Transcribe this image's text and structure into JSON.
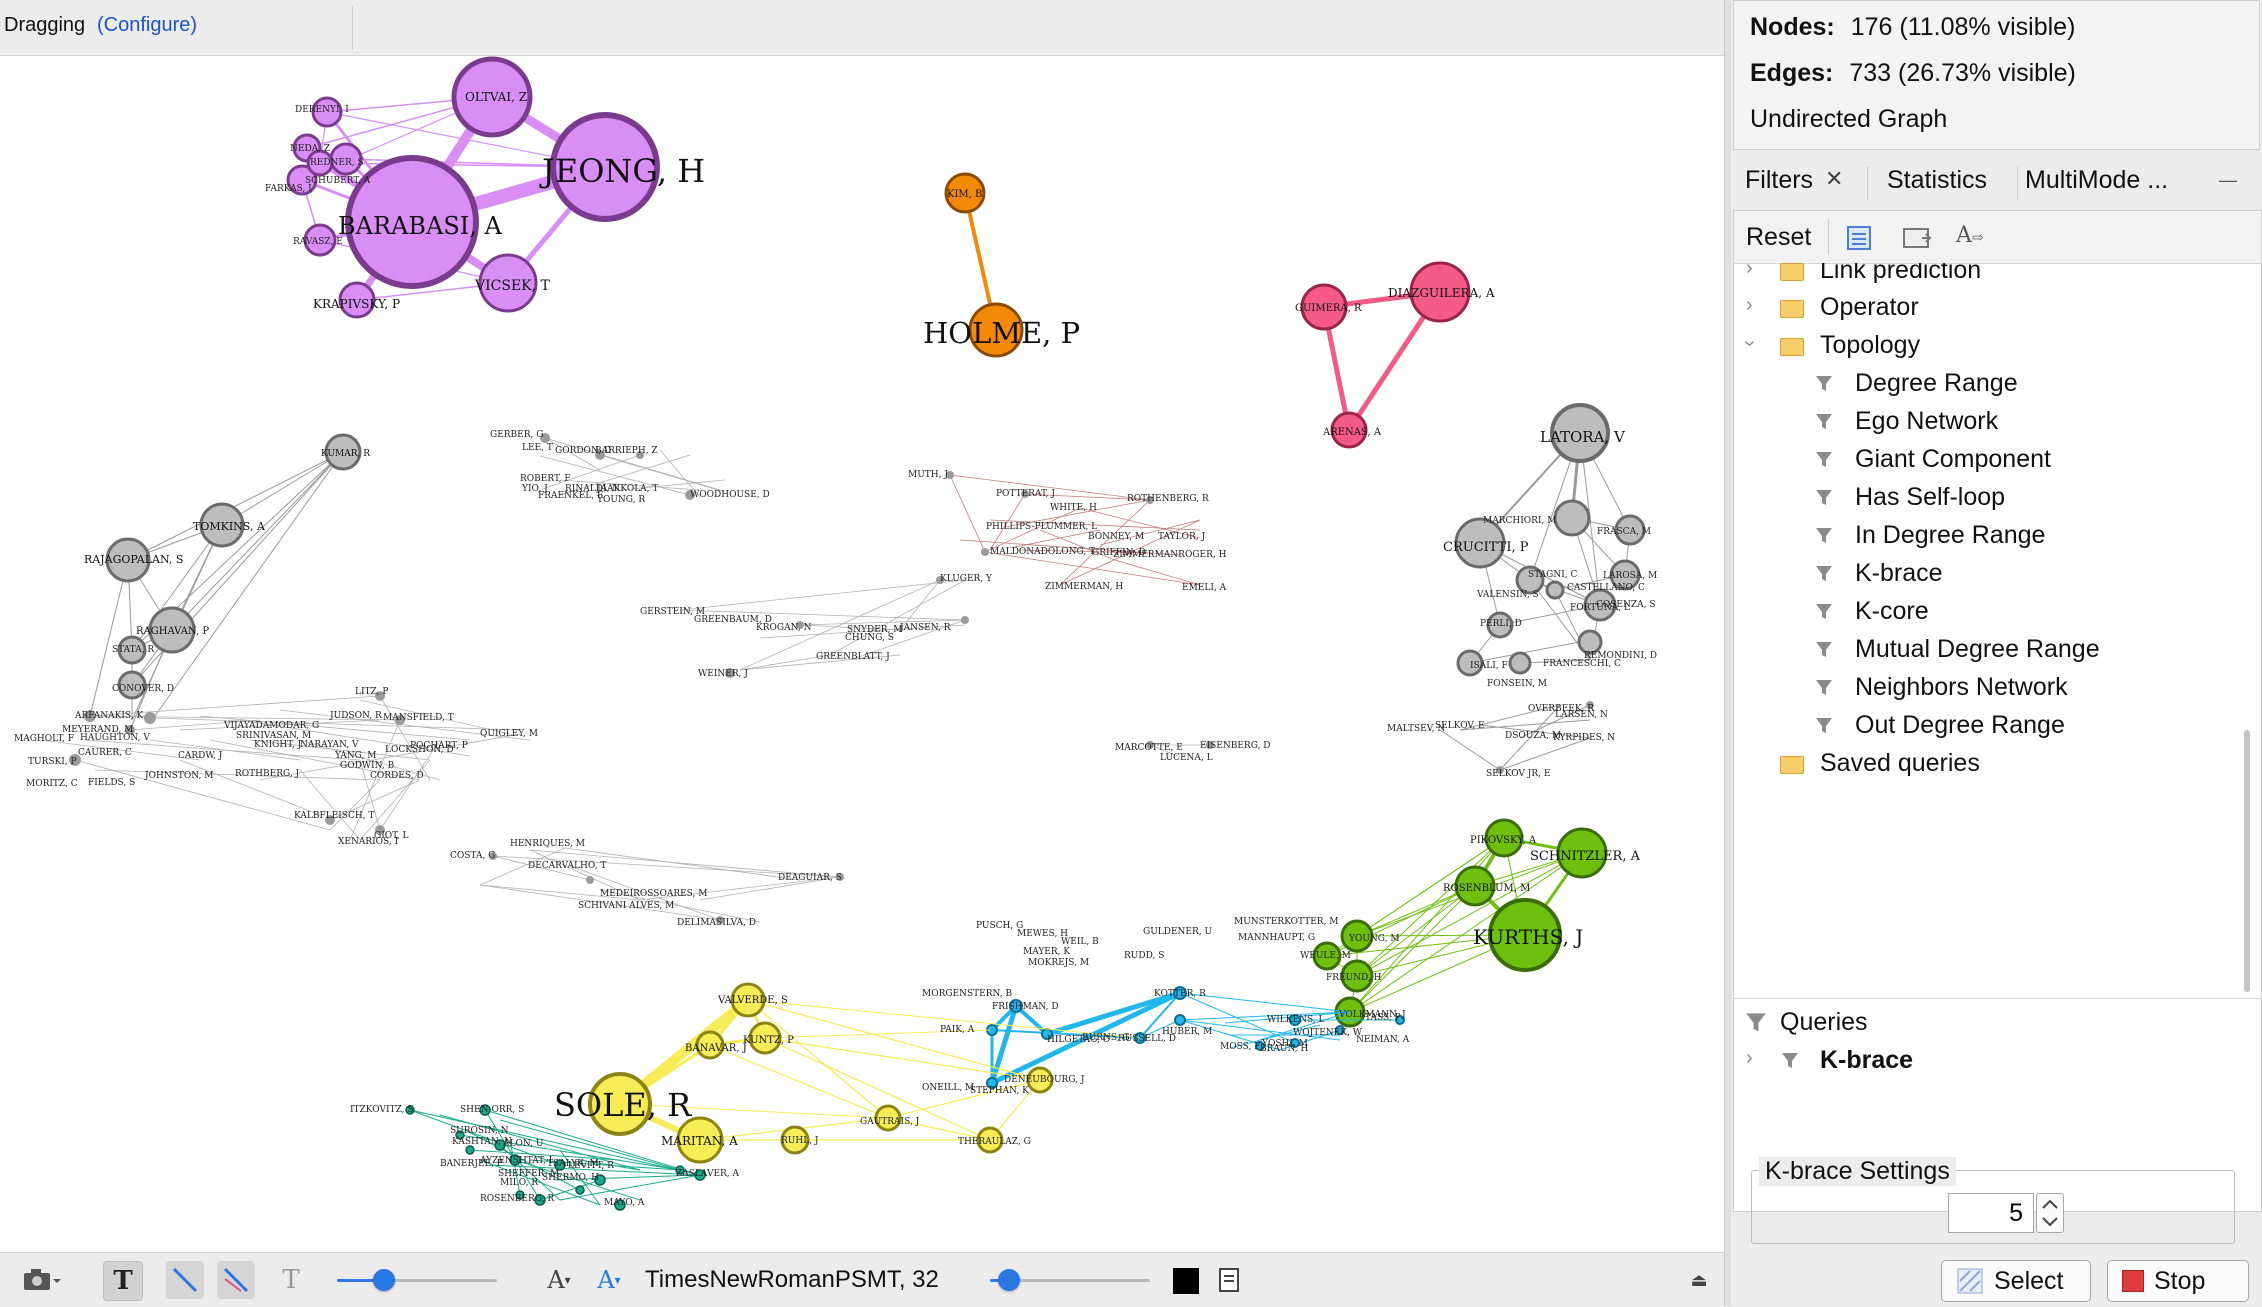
{
  "toolbar": {
    "mode": "Dragging",
    "configure": "(Configure)"
  },
  "bottom_toolbar": {
    "font_label": "TimesNewRomanPSMT, 32",
    "icons": [
      "camera-icon",
      "text-bold-icon",
      "edge-pen-icon",
      "edge-color-icon",
      "text-size-icon",
      "font-size-a-icon",
      "font-a-icon",
      "color-swatch-icon",
      "export-icon",
      "collapse-icon"
    ]
  },
  "context": {
    "nodes_label": "Nodes:",
    "nodes_value": "176 (11.08% visible)",
    "edges_label": "Edges:",
    "edges_value": "733 (26.73% visible)",
    "graph_type": "Undirected Graph"
  },
  "tabs": {
    "filters": "Filters",
    "statistics": "Statistics",
    "multimode": "MultiMode ...",
    "close": "✕",
    "minimize": "—"
  },
  "filters": {
    "reset": "Reset",
    "tree": [
      {
        "label": "Link prediction",
        "type": "folder",
        "expanded": false
      },
      {
        "label": "Operator",
        "type": "folder",
        "expanded": false
      },
      {
        "label": "Topology",
        "type": "folder",
        "expanded": true
      },
      {
        "label": "Degree Range",
        "type": "filter"
      },
      {
        "label": "Ego Network",
        "type": "filter"
      },
      {
        "label": "Giant Component",
        "type": "filter"
      },
      {
        "label": "Has Self-loop",
        "type": "filter"
      },
      {
        "label": "In Degree Range",
        "type": "filter"
      },
      {
        "label": "K-brace",
        "type": "filter"
      },
      {
        "label": "K-core",
        "type": "filter"
      },
      {
        "label": "Mutual Degree Range",
        "type": "filter"
      },
      {
        "label": "Neighbors Network",
        "type": "filter"
      },
      {
        "label": "Out Degree Range",
        "type": "filter"
      },
      {
        "label": "Saved queries",
        "type": "folder"
      }
    ],
    "queries_label": "Queries",
    "query_item": "K-brace"
  },
  "kbrace": {
    "title": "K-brace Settings",
    "value": "5"
  },
  "buttons": {
    "select": "Select",
    "stop": "Stop"
  },
  "colors": {
    "purple": "#d88ef5",
    "orange": "#f28a06",
    "pink": "#f35a87",
    "gray": "#bdbdbd",
    "green": "#6fbf0f",
    "yellow": "#f6ec55",
    "cyan": "#20b7ec",
    "teal": "#1aa98a",
    "accent": "#2a76e3"
  },
  "graph": {
    "big_labels": {
      "barabasi": "BARABASI, A",
      "jeong": "JEONG, H",
      "holme": "HOLME, P",
      "sole": "SOLE, R",
      "kurths": "KURTHS, J"
    },
    "medium_labels": {
      "oltvai": "OLTVAI, Z",
      "vicsek": "VICSEK, T",
      "krapivsky": "KRAPIVSKY, P",
      "diazguilera": "DIAZGUILERA, A",
      "guimera": "GUIMERA, R",
      "arenas": "ARENAS, A",
      "kim": "KIM, B",
      "latora": "LATORA, V",
      "crucitti": "CRUCITTI, P",
      "schnitzler": "SCHNITZLER, A",
      "pikovsky": "PIKOVSKY, A",
      "rosenblum": "ROSENBLUM, M",
      "maritan": "MARITAN, A",
      "valverde": "VALVERDE, S",
      "kuntz": "KUNTZ, P",
      "banavar": "BANAVAR, J",
      "tomkins": "TOMKINS, A",
      "rajagopalan": "RAJAGOPALAN, S",
      "raghavan": "RAGHAVAN, P",
      "kumar": "KUMAR, R"
    },
    "small_labels": [
      "DERENYI, I",
      "NEDA, Z",
      "REDNER, S",
      "FARKAS, I",
      "SCHUBERT, A",
      "RAVASZ, E",
      "GERBER, G",
      "LEE, T",
      "GORDON, D",
      "BARRIEPH, Z",
      "ROBERT, F",
      "YIO, J",
      "RINALDI, N",
      "JAAKKOLA, T",
      "FRAENKEL, E",
      "YOUNG, R",
      "WOODHOUSE, D",
      "MUTH, J",
      "POTTERAT, J",
      "ROTHENBERG, R",
      "WHITE, H",
      "PHILLIPS-PLUMMER, L",
      "BONNEY, M",
      "TAYLOR, J",
      "MALDONADOLONG, T",
      "GRIFFIN, D",
      "ZIMMERMANROGER, H",
      "ZIMMERMAN, H",
      "EMELI, A",
      "KLUGER, Y",
      "GERSTEIN, M",
      "GREENBAUM, D",
      "KROGAN, N",
      "SNYDER, M",
      "CHUNG, S",
      "JANSEN, R",
      "GREENBLATT, J",
      "WEINER, J",
      "STATA, R",
      "CONOVER, D",
      "LITZ, P",
      "JUDSON, R",
      "MANSFIELD, T",
      "ARFANAKIS, K",
      "MAGHOLT, F",
      "MEYERAND, M",
      "HAUGHTON, V",
      "CAURER, C",
      "VIJAYADAMODAR, G",
      "SRINIVASAN, M",
      "KNIGHT, J",
      "NARAYAN, V",
      "YANG, M",
      "LOCKSHON, D",
      "POCHART, P",
      "QUIGLEY, M",
      "CARDW, J",
      "JOHNSTON, M",
      "ROTHBERG, J",
      "GODWIN, B",
      "CORDES, D",
      "TURSKI, P",
      "MORITZ, C",
      "FIELDS, S",
      "KALBFLEISCH, T",
      "GIOT, L",
      "XENARIOS, I",
      "MARCOTTE, E",
      "EISENBERG, D",
      "LUCENA, L",
      "COSTA, G",
      "HENRIQUES, M",
      "DECARVALHO, T",
      "DEAGUIAR, S",
      "MEDEIROSSOARES, M",
      "SCHIVANI ALVES, M",
      "DELIMASILVA, D",
      "MARCHIORI, M",
      "FRASCA, M",
      "LAROSA, M",
      "STAGNI, C",
      "CASTELLANO, C",
      "VALENSIN, S",
      "FORTUNA, L",
      "PERLI, D",
      "COSENZA, S",
      "REMONDINI, D",
      "ISALI, F",
      "FRANCESCHI, C",
      "FONSEIN, M",
      "OVERBEEK, R",
      "LARSEN, N",
      "MALTSEV, N",
      "SELKOV, E",
      "DSOUZA, M",
      "KYRPIDES, N",
      "SELKOV JR, E",
      "PUSCH, G",
      "MEWES, H",
      "WEIL, B",
      "MAYER, K",
      "MOKREJS, M",
      "GULDENER, U",
      "MUNSTERKOTTER, M",
      "MANNHAUPT, G",
      "RUDD, S",
      "MORGENSTERN, B",
      "FRISHMAN, D",
      "KOTTER, R",
      "YOUNG, M",
      "WEULE, M",
      "FREUND, H",
      "VOLKMANN, J",
      "TASS, P",
      "WILKENS, L",
      "WOJTENEK, W",
      "YOSHI, M",
      "NEIMAN, A",
      "MOSS, F",
      "BRAUN, H",
      "HUBER, M",
      "PAIK, A",
      "HILGETAG, C",
      "BURNS, G",
      "RUSSELL, D",
      "ONEILL, M",
      "STEPHAN, K",
      "DENEUBOURG, J",
      "GAUTRAIS, J",
      "THERAULAZ, G",
      "RUHL, J",
      "ITZKOVITZ, S",
      "SHEN-ORR, S",
      "SUROSIN, N",
      "KASHTAN, N",
      "ALON, U",
      "AYZENSHTAT, I",
      "SHEFFER, M",
      "BANERJEE, P",
      "TSALYK, M",
      "LEVITT, R",
      "SHERMO, H",
      "MILO, R",
      "ZASLAVER, A",
      "ROSENBERG, R",
      "MAYO, A"
    ]
  }
}
